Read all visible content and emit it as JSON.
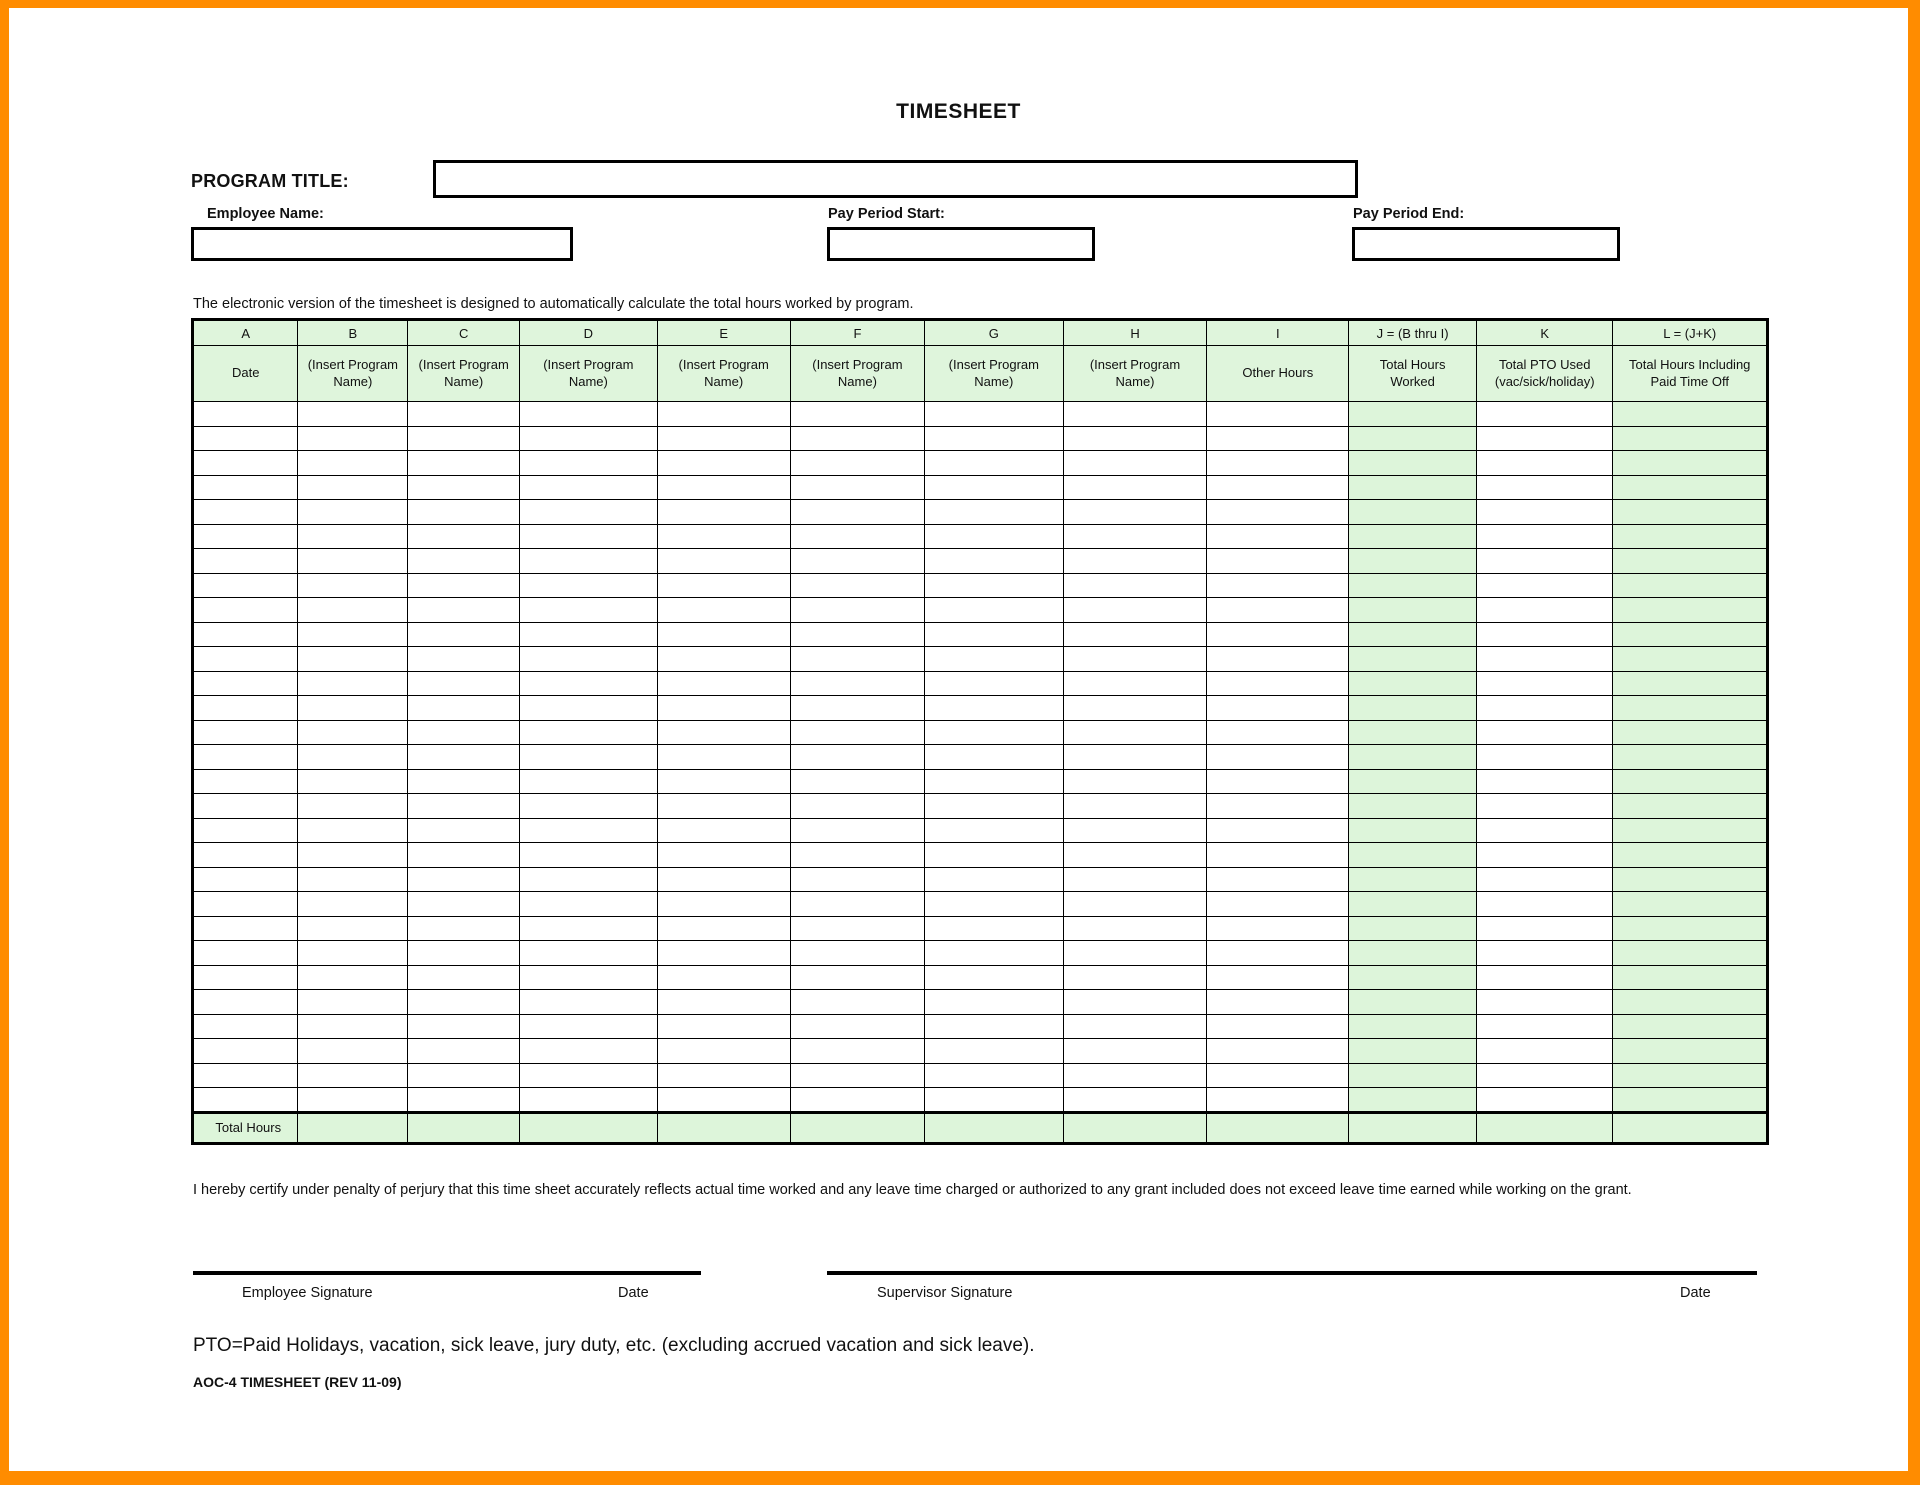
{
  "document": {
    "title": "TIMESHEET",
    "form_code": "AOC-4 TIMESHEET (REV 11-09)"
  },
  "header": {
    "program_title_label": "PROGRAM TITLE:",
    "program_title_value": "",
    "employee_name_label": "Employee Name:",
    "employee_name_value": "",
    "pay_period_start_label": "Pay Period Start:",
    "pay_period_start_value": "",
    "pay_period_end_label": "Pay Period End:",
    "pay_period_end_value": ""
  },
  "intro": {
    "text": "The electronic version of the timesheet is designed to automatically calculate the total hours worked by program."
  },
  "table": {
    "column_letters": [
      "A",
      "B",
      "C",
      "D",
      "E",
      "F",
      "G",
      "H",
      "I",
      "J = (B thru I)",
      "K",
      "L = (J+K)"
    ],
    "column_descriptions": [
      {
        "line1": "Date",
        "line2": ""
      },
      {
        "line1": "(Insert Program",
        "line2": "Name)"
      },
      {
        "line1": "(Insert Program",
        "line2": "Name)"
      },
      {
        "line1": "(Insert Program",
        "line2": "Name)"
      },
      {
        "line1": "(Insert Program",
        "line2": "Name)"
      },
      {
        "line1": "(Insert Program",
        "line2": "Name)"
      },
      {
        "line1": "(Insert Program",
        "line2": "Name)"
      },
      {
        "line1": "(Insert Program",
        "line2": "Name)"
      },
      {
        "line1": "Other Hours",
        "line2": ""
      },
      {
        "line1": "Total Hours",
        "line2": "Worked"
      },
      {
        "line1": "Total PTO Used",
        "line2": "(vac/sick/holiday)"
      },
      {
        "line1": "Total Hours Including",
        "line2": "Paid Time Off"
      }
    ],
    "body_row_count": 29,
    "shaded_column_indexes": [
      9,
      11
    ],
    "total_row_label": "Total Hours",
    "total_row_values": [
      "",
      "",
      "",
      "",
      "",
      "",
      "",
      "",
      "",
      "",
      ""
    ]
  },
  "certification": {
    "text": "I hereby certify under penalty of perjury that this time sheet accurately reflects actual time worked and any leave time charged or authorized to any grant included does not exceed leave time earned while working on the grant."
  },
  "signatures": {
    "employee_signature_caption": "Employee Signature",
    "employee_date_caption": "Date",
    "supervisor_signature_caption": "Supervisor Signature",
    "supervisor_date_caption": "Date"
  },
  "footer": {
    "pto_note": "PTO=Paid Holidays, vacation, sick leave, jury duty, etc. (excluding accrued vacation and sick leave)."
  },
  "colors": {
    "page_frame": "#FF8C00",
    "header_shade": "#dff5dc",
    "cell_shade": "#ddf5da",
    "rule": "#000000"
  }
}
